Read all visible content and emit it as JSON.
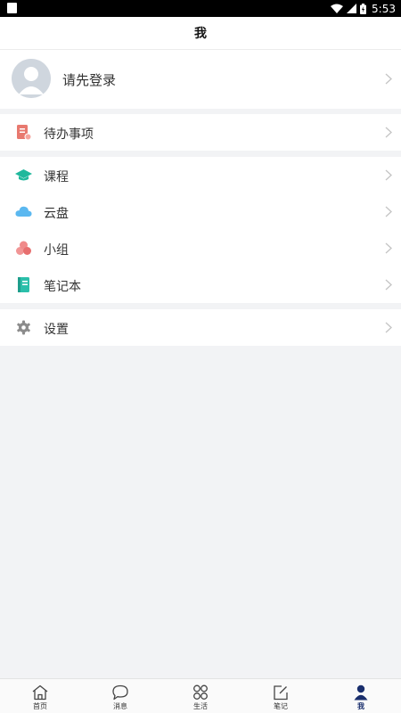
{
  "status_bar": {
    "time": "5:53"
  },
  "header": {
    "title": "我"
  },
  "profile": {
    "label": "请先登录"
  },
  "groups": [
    {
      "items": [
        {
          "label": "待办事项",
          "icon": "todo-icon"
        }
      ]
    },
    {
      "items": [
        {
          "label": "课程",
          "icon": "graduation-cap-icon"
        },
        {
          "label": "云盘",
          "icon": "cloud-icon"
        },
        {
          "label": "小组",
          "icon": "group-icon"
        },
        {
          "label": "笔记本",
          "icon": "notebook-icon"
        }
      ]
    },
    {
      "items": [
        {
          "label": "设置",
          "icon": "gear-icon"
        }
      ]
    }
  ],
  "bottom_nav": {
    "items": [
      {
        "label": "首页",
        "icon": "home-icon"
      },
      {
        "label": "消息",
        "icon": "chat-bubble-icon"
      },
      {
        "label": "生活",
        "icon": "apps-grid-icon"
      },
      {
        "label": "笔记",
        "icon": "edit-note-icon"
      },
      {
        "label": "我",
        "icon": "person-icon",
        "active": true
      }
    ]
  },
  "colors": {
    "todo": "#e8796f",
    "course": "#1fb89c",
    "cloud": "#5bb8f0",
    "group": "#f08a8a",
    "notebook": "#2bbfaa",
    "settings": "#8c8c8c",
    "nav_active": "#1a2f6d"
  }
}
